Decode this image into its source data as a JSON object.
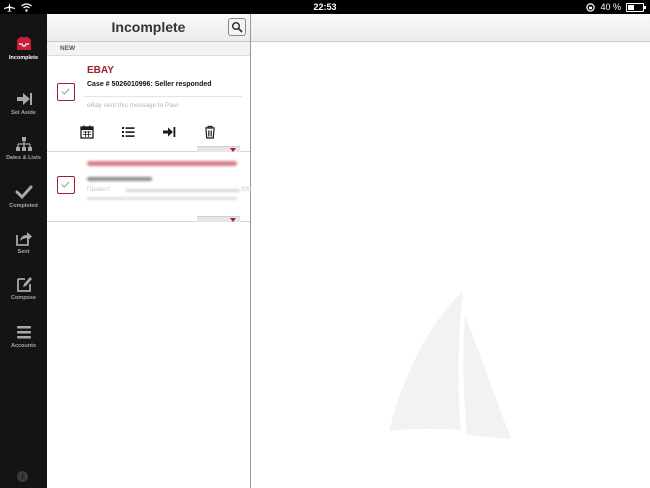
{
  "statusbar": {
    "time": "22:53",
    "battery": "40 %",
    "battery_level": 0.4
  },
  "sidebar": {
    "items": [
      {
        "label": "Incomplete",
        "icon": "inbox-icon",
        "active": true
      },
      {
        "label": "Set Aside",
        "icon": "set-aside-icon",
        "active": false
      },
      {
        "label": "Dates & Lists",
        "icon": "dates-lists-icon",
        "active": false
      },
      {
        "label": "Completed",
        "icon": "checkmark-icon",
        "active": false
      },
      {
        "label": "Sent",
        "icon": "sent-icon",
        "active": false
      },
      {
        "label": "Compose",
        "icon": "compose-icon",
        "active": false
      },
      {
        "label": "Accounts",
        "icon": "accounts-icon",
        "active": false
      }
    ]
  },
  "list": {
    "title": "Incomplete",
    "section": "NEW",
    "items": [
      {
        "sender": "EBAY",
        "subject": "Case # 5026010996: Seller responded",
        "preview": "eBay sent this message to Paul"
      },
      {
        "preview_start": "Привет!",
        "preview_end": "SSD"
      }
    ]
  },
  "colors": {
    "accent": "#9b2230",
    "sidebar_bg": "#141414"
  }
}
